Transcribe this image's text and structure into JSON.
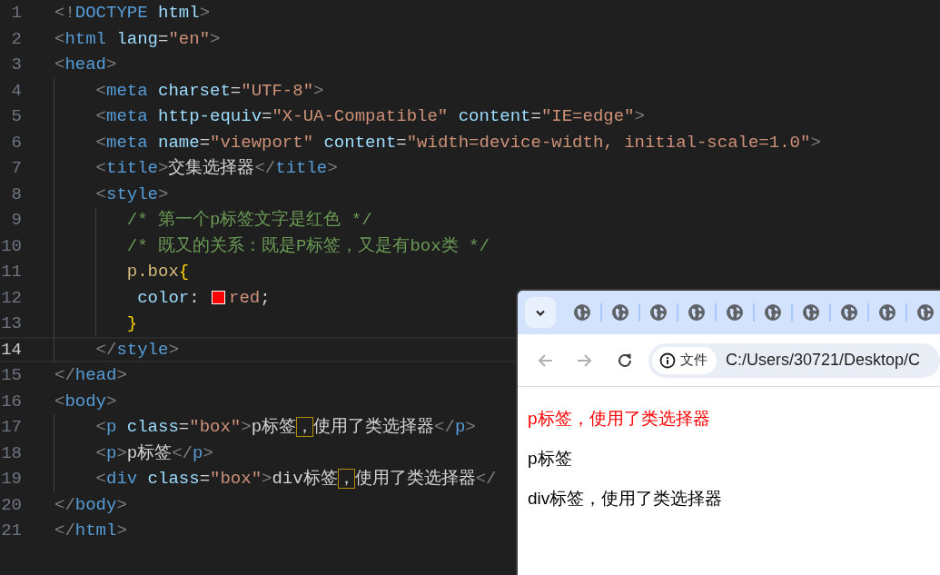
{
  "editor": {
    "lines": [
      {
        "number": "1",
        "current": false,
        "segments": [
          {
            "kind": "code",
            "tokens": [
              {
                "kind": "punct",
                "s": "<!"
              },
              {
                "kind": "tag",
                "s": "DOCTYPE"
              },
              {
                "kind": "attr",
                "s": " html"
              },
              {
                "kind": "punct",
                "s": ">"
              }
            ]
          }
        ]
      },
      {
        "number": "2",
        "current": false,
        "segments": [
          {
            "kind": "code",
            "tokens": [
              {
                "kind": "punct",
                "s": "<"
              },
              {
                "kind": "tag",
                "s": "html"
              },
              {
                "kind": "attr",
                "s": " lang"
              },
              {
                "kind": "plain",
                "s": "="
              },
              {
                "kind": "str",
                "s": "\"en\""
              },
              {
                "kind": "punct",
                "s": ">"
              }
            ]
          }
        ]
      },
      {
        "number": "3",
        "current": false,
        "segments": [
          {
            "kind": "code",
            "tokens": [
              {
                "kind": "punct",
                "s": "<"
              },
              {
                "kind": "tag",
                "s": "head"
              },
              {
                "kind": "punct",
                "s": ">"
              }
            ]
          }
        ],
        "children": [
          {
            "number": "4",
            "current": false,
            "segments": [
              {
                "kind": "code",
                "tokens": [
                  {
                    "kind": "punct",
                    "s": "<"
                  },
                  {
                    "kind": "tag",
                    "s": "meta"
                  },
                  {
                    "kind": "attr",
                    "s": " charset"
                  },
                  {
                    "kind": "plain",
                    "s": "="
                  },
                  {
                    "kind": "str",
                    "s": "\"UTF-8\""
                  },
                  {
                    "kind": "punct",
                    "s": ">"
                  }
                ]
              }
            ]
          },
          {
            "number": "5",
            "current": false,
            "segments": [
              {
                "kind": "code",
                "tokens": [
                  {
                    "kind": "punct",
                    "s": "<"
                  },
                  {
                    "kind": "tag",
                    "s": "meta"
                  },
                  {
                    "kind": "attr",
                    "s": " http-equiv"
                  },
                  {
                    "kind": "plain",
                    "s": "="
                  },
                  {
                    "kind": "str",
                    "s": "\"X-UA-Compatible\""
                  },
                  {
                    "kind": "attr",
                    "s": " content"
                  },
                  {
                    "kind": "plain",
                    "s": "="
                  },
                  {
                    "kind": "str",
                    "s": "\"IE=edge\""
                  },
                  {
                    "kind": "punct",
                    "s": ">"
                  }
                ]
              }
            ]
          },
          {
            "number": "6",
            "current": false,
            "segments": [
              {
                "kind": "code",
                "tokens": [
                  {
                    "kind": "punct",
                    "s": "<"
                  },
                  {
                    "kind": "tag",
                    "s": "meta"
                  },
                  {
                    "kind": "attr",
                    "s": " name"
                  },
                  {
                    "kind": "plain",
                    "s": "="
                  },
                  {
                    "kind": "str",
                    "s": "\"viewport\""
                  },
                  {
                    "kind": "attr",
                    "s": " content"
                  },
                  {
                    "kind": "plain",
                    "s": "="
                  },
                  {
                    "kind": "str",
                    "s": "\"width=device-width, initial-scale=1.0\""
                  },
                  {
                    "kind": "punct",
                    "s": ">"
                  }
                ]
              }
            ]
          },
          {
            "number": "7",
            "current": false,
            "segments": [
              {
                "kind": "code",
                "tokens": [
                  {
                    "kind": "punct",
                    "s": "<"
                  },
                  {
                    "kind": "tag",
                    "s": "title"
                  },
                  {
                    "kind": "punct",
                    "s": ">"
                  },
                  {
                    "kind": "plain",
                    "s": "交集选择器"
                  },
                  {
                    "kind": "punct",
                    "s": "</"
                  },
                  {
                    "kind": "tag",
                    "s": "title"
                  },
                  {
                    "kind": "punct",
                    "s": ">"
                  }
                ]
              }
            ]
          },
          {
            "number": "8",
            "current": false,
            "segments": [
              {
                "kind": "code",
                "tokens": [
                  {
                    "kind": "punct",
                    "s": "<"
                  },
                  {
                    "kind": "tag",
                    "s": "style"
                  },
                  {
                    "kind": "punct",
                    "s": ">"
                  }
                ]
              }
            ],
            "children": [
              {
                "number": "9",
                "current": false,
                "segments": [
                  {
                    "kind": "code",
                    "tokens": [
                      {
                        "kind": "comment",
                        "s": "/* 第一个p标签文字是红色 */"
                      }
                    ]
                  }
                ]
              },
              {
                "number": "10",
                "current": false,
                "segments": [
                  {
                    "kind": "code",
                    "tokens": [
                      {
                        "kind": "comment",
                        "s": "/* 既又的关系：既是P标签，又是有box类 */"
                      }
                    ]
                  }
                ]
              },
              {
                "number": "11",
                "current": false,
                "segments": [
                  {
                    "kind": "code",
                    "tokens": [
                      {
                        "kind": "selector",
                        "s": "p.box"
                      },
                      {
                        "kind": "brace",
                        "s": "{"
                      }
                    ]
                  }
                ],
                "children": [
                  {
                    "number": "12",
                    "current": false,
                    "segments": [
                      {
                        "kind": "code",
                        "tokens": [
                          {
                            "kind": "attr",
                            "s": "color"
                          },
                          {
                            "kind": "plain",
                            "s": ":"
                          }
                        ]
                      },
                      {
                        "kind": "swatch",
                        "color": "#ff0000"
                      },
                      {
                        "kind": "code",
                        "tokens": [
                          {
                            "kind": "str",
                            "s": "red"
                          },
                          {
                            "kind": "plain",
                            "s": ";"
                          }
                        ]
                      }
                    ]
                  }
                ]
              },
              {
                "number": "13",
                "current": false,
                "segments": [
                  {
                    "kind": "code",
                    "tokens": [
                      {
                        "kind": "brace",
                        "s": "}"
                      }
                    ]
                  }
                ]
              }
            ]
          },
          {
            "number": "14",
            "current": true,
            "segments": [
              {
                "kind": "code",
                "tokens": [
                  {
                    "kind": "punct",
                    "s": "</"
                  },
                  {
                    "kind": "tag",
                    "s": "style"
                  },
                  {
                    "kind": "punct",
                    "s": ">"
                  }
                ]
              }
            ]
          }
        ]
      },
      {
        "number": "15",
        "current": false,
        "segments": [
          {
            "kind": "code",
            "tokens": [
              {
                "kind": "punct",
                "s": "</"
              },
              {
                "kind": "tag",
                "s": "head"
              },
              {
                "kind": "punct",
                "s": ">"
              }
            ]
          }
        ]
      },
      {
        "number": "16",
        "current": false,
        "segments": [
          {
            "kind": "code",
            "tokens": [
              {
                "kind": "punct",
                "s": "<"
              },
              {
                "kind": "tag",
                "s": "body"
              },
              {
                "kind": "punct",
                "s": ">"
              }
            ]
          }
        ],
        "children": [
          {
            "number": "17",
            "current": false,
            "segments": [
              {
                "kind": "code",
                "tokens": [
                  {
                    "kind": "punct",
                    "s": "<"
                  },
                  {
                    "kind": "tag",
                    "s": "p"
                  },
                  {
                    "kind": "attr",
                    "s": " class"
                  },
                  {
                    "kind": "plain",
                    "s": "="
                  },
                  {
                    "kind": "str",
                    "s": "\"box\""
                  },
                  {
                    "kind": "punct",
                    "s": ">"
                  },
                  {
                    "kind": "plain",
                    "s": "p标签"
                  },
                  {
                    "kind": "unicode",
                    "s": "，"
                  },
                  {
                    "kind": "plain",
                    "s": "使用了类选择器"
                  },
                  {
                    "kind": "punct",
                    "s": "</"
                  },
                  {
                    "kind": "tag",
                    "s": "p"
                  },
                  {
                    "kind": "punct",
                    "s": ">"
                  }
                ]
              }
            ]
          },
          {
            "number": "18",
            "current": false,
            "segments": [
              {
                "kind": "code",
                "tokens": [
                  {
                    "kind": "punct",
                    "s": "<"
                  },
                  {
                    "kind": "tag",
                    "s": "p"
                  },
                  {
                    "kind": "punct",
                    "s": ">"
                  },
                  {
                    "kind": "plain",
                    "s": "p标签"
                  },
                  {
                    "kind": "punct",
                    "s": "</"
                  },
                  {
                    "kind": "tag",
                    "s": "p"
                  },
                  {
                    "kind": "punct",
                    "s": ">"
                  }
                ]
              }
            ]
          },
          {
            "number": "19",
            "current": false,
            "segments": [
              {
                "kind": "code",
                "tokens": [
                  {
                    "kind": "punct",
                    "s": "<"
                  },
                  {
                    "kind": "tag",
                    "s": "div"
                  },
                  {
                    "kind": "attr",
                    "s": " class"
                  },
                  {
                    "kind": "plain",
                    "s": "="
                  },
                  {
                    "kind": "str",
                    "s": "\"box\""
                  },
                  {
                    "kind": "punct",
                    "s": ">"
                  },
                  {
                    "kind": "plain",
                    "s": "div标签"
                  },
                  {
                    "kind": "unicode",
                    "s": "，"
                  },
                  {
                    "kind": "plain",
                    "s": "使用了类选择器"
                  },
                  {
                    "kind": "punct",
                    "s": "</"
                  }
                ]
              }
            ]
          }
        ]
      },
      {
        "number": "20",
        "current": false,
        "segments": [
          {
            "kind": "code",
            "tokens": [
              {
                "kind": "punct",
                "s": "</"
              },
              {
                "kind": "tag",
                "s": "body"
              },
              {
                "kind": "punct",
                "s": ">"
              }
            ]
          }
        ]
      },
      {
        "number": "21",
        "current": false,
        "segments": [
          {
            "kind": "code",
            "tokens": [
              {
                "kind": "punct",
                "s": "</"
              },
              {
                "kind": "tag",
                "s": "html"
              },
              {
                "kind": "punct",
                "s": ">"
              }
            ]
          }
        ]
      }
    ]
  },
  "browser": {
    "tabs": [
      {
        "kind": "page"
      },
      {
        "kind": "page"
      },
      {
        "kind": "page"
      },
      {
        "kind": "page"
      },
      {
        "kind": "page"
      },
      {
        "kind": "page"
      },
      {
        "kind": "page"
      },
      {
        "kind": "page"
      },
      {
        "kind": "page"
      },
      {
        "kind": "page"
      }
    ],
    "nav_buttons": [
      {
        "kind": "back",
        "disabled": true
      },
      {
        "kind": "forward",
        "disabled": true
      },
      {
        "kind": "reload",
        "disabled": false
      }
    ],
    "site_chip": "文件",
    "url": "C:/Users/30721/Desktop/C",
    "paragraphs": [
      {
        "text": "p标签，使用了类选择器",
        "color": "#ff0000"
      },
      {
        "text": "p标签",
        "color": "#000000"
      },
      {
        "text": "div标签，使用了类选择器",
        "color": "#000000"
      }
    ]
  }
}
